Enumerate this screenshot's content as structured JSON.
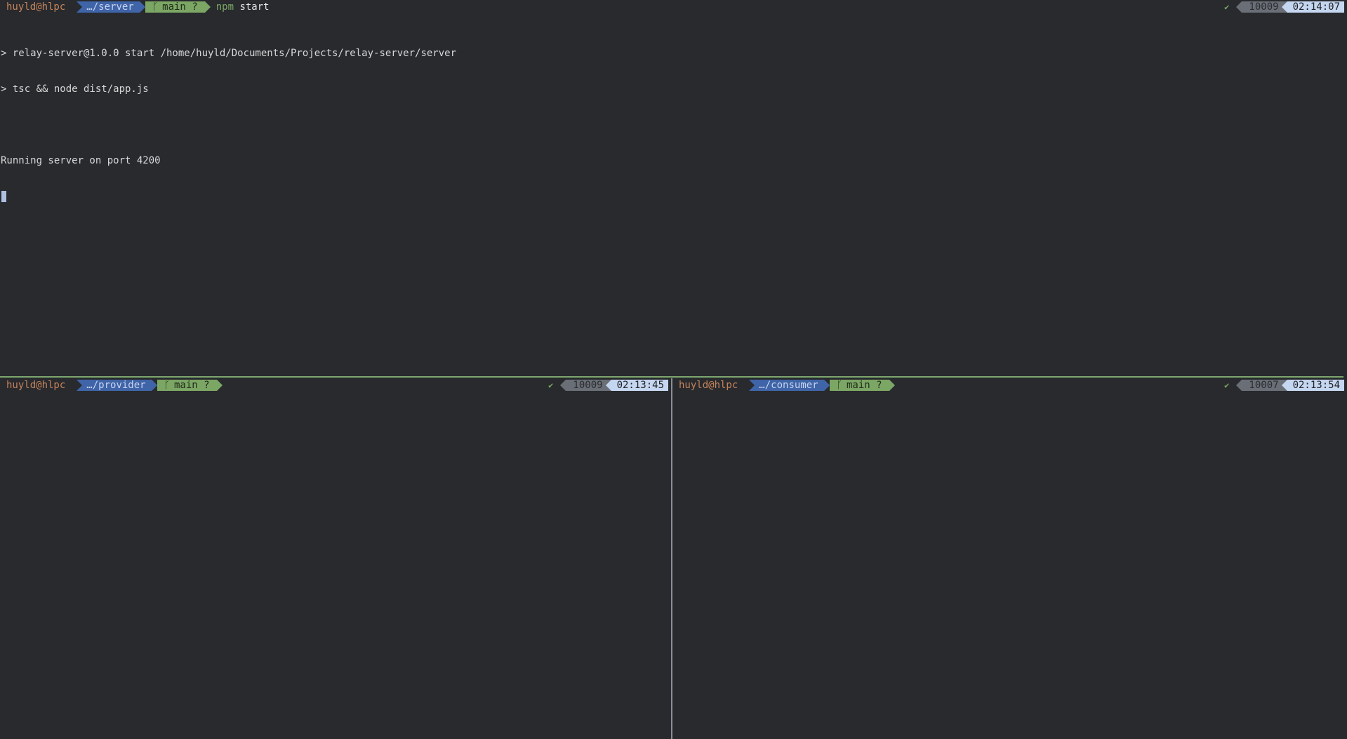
{
  "colors": {
    "background": "#282a2e",
    "user": "#c6845a",
    "dir_segment": "#3f64a8",
    "git_segment": "#7ba664",
    "count_segment": "#6a6f77",
    "time_segment": "#c5d6f0",
    "horizontal_divider": "#7da66d"
  },
  "panes": {
    "top": {
      "user": "huyld@hlpc",
      "dir": "…/server",
      "branch_icon": "git-branch-icon",
      "branch": "main ?",
      "command_bin": "npm",
      "command_arg": "start",
      "status_check": "✔",
      "history_number": "10009",
      "time": "02:14:07",
      "output": [
        "> relay-server@1.0.0 start /home/huyld/Documents/Projects/relay-server/server",
        "> tsc && node dist/app.js",
        "",
        "Running server on port 4200"
      ]
    },
    "bottom_left": {
      "user": "huyld@hlpc",
      "dir": "…/provider",
      "branch": "main ?",
      "status_check": "✔",
      "history_number": "10009",
      "time": "02:13:45"
    },
    "bottom_right": {
      "user": "huyld@hlpc",
      "dir": "…/consumer",
      "branch": "main ?",
      "status_check": "✔",
      "history_number": "10007",
      "time": "02:13:54"
    }
  }
}
